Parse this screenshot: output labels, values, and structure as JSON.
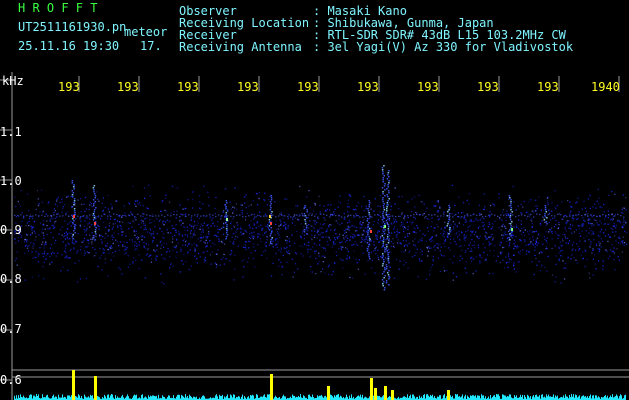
{
  "header": {
    "app_name": "H R O F F T",
    "filename": "UT2511161930.pn",
    "meteor_label": "meteor",
    "datetime": "25.11.16 19:30",
    "count": "17.",
    "fields": [
      {
        "label": "Observer",
        "value": ": Masaki Kano"
      },
      {
        "label": "Receiving Location",
        "value": ": Shibukawa, Gunma, Japan"
      },
      {
        "label": "Receiver",
        "value": ": RTL-SDR SDR# 43dB L15 103.2MHz CW"
      },
      {
        "label": "Receiving Antenna",
        "value": ": 3el Yagi(V) Az 330 for Vladivostok"
      }
    ]
  },
  "axis": {
    "unit": "kHz",
    "y_ticks": [
      "1.1",
      "1.0",
      "0.9",
      "0.8",
      "0.7",
      "0.6"
    ],
    "time_ticks": [
      "193",
      "193",
      "193",
      "193",
      "193",
      "193",
      "193",
      "193",
      "193",
      "1940"
    ]
  },
  "colors": {
    "grid": "#9a9a9a",
    "text_header": "#39ff3f",
    "text_info": "#7ff5ff",
    "tick": "#ffff22",
    "signal": "#1b2cff",
    "meter": "#22e8ff",
    "meter_peak": "#ffff00"
  }
}
